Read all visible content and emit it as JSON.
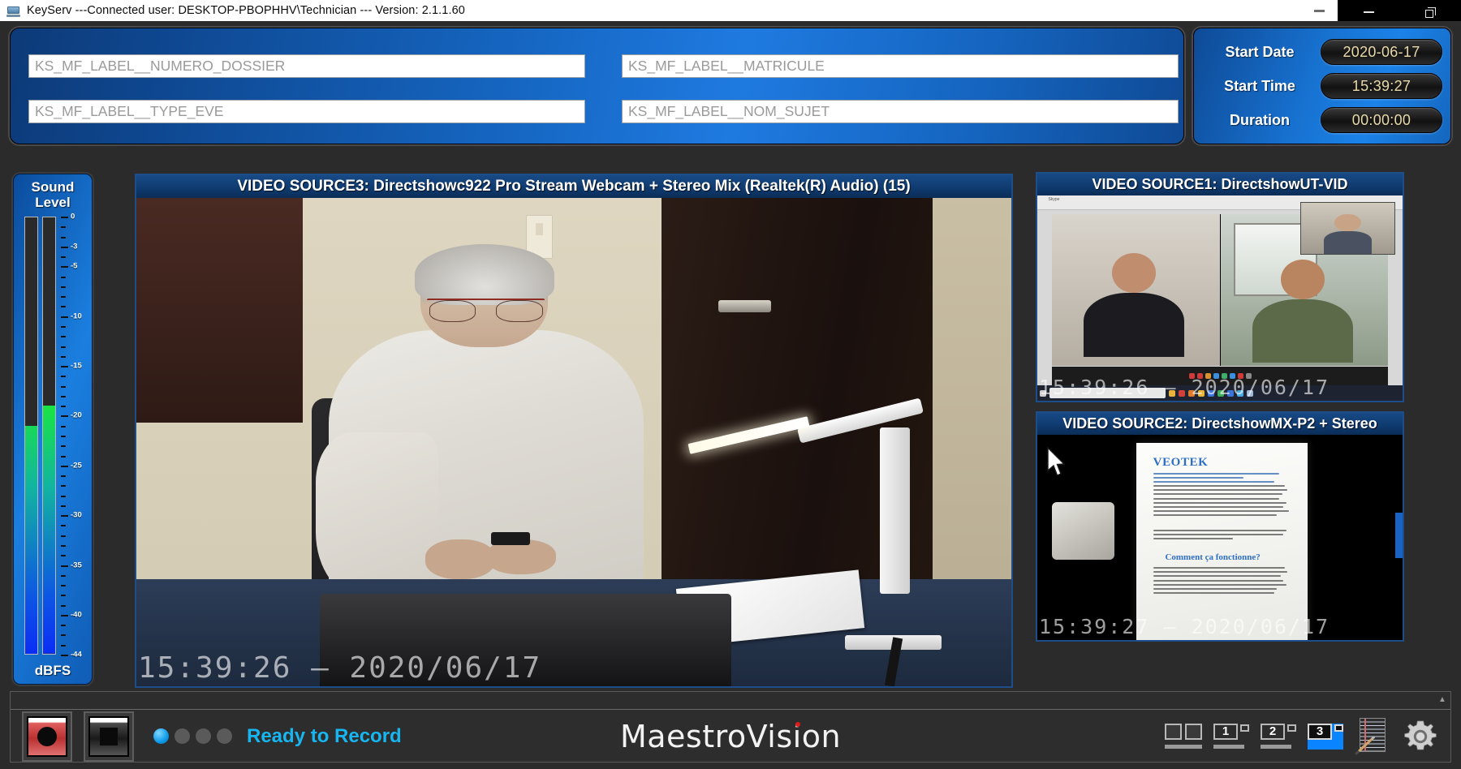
{
  "titlebar": {
    "app_icon": "keyserv-icon",
    "title": "KeyServ ---Connected user:  DESKTOP-PBOPHHV\\Technician --- Version:  2.1.1.60",
    "minimize_label": "–",
    "restore_label": "❐"
  },
  "header_form": {
    "fields": [
      {
        "name": "numero-dossier",
        "placeholder": "KS_MF_LABEL__NUMERO_DOSSIER",
        "value": ""
      },
      {
        "name": "type-eve",
        "placeholder": "KS_MF_LABEL__TYPE_EVE",
        "value": ""
      },
      {
        "name": "matricule",
        "placeholder": "KS_MF_LABEL__MATRICULE",
        "value": ""
      },
      {
        "name": "nom-sujet",
        "placeholder": "KS_MF_LABEL__NOM_SUJET",
        "value": ""
      }
    ]
  },
  "time_panel": {
    "rows": [
      {
        "label": "Start Date",
        "value": "2020-06-17"
      },
      {
        "label": "Start Time",
        "value": "15:39:27"
      },
      {
        "label": "Duration",
        "value": "00:00:00"
      }
    ],
    "value_color": "#e8d9a8"
  },
  "sound_meter": {
    "title_line1": "Sound",
    "title_line2": "Level",
    "unit": "dBFS",
    "scale_labels": [
      "0",
      "-3",
      "-5",
      "-10",
      "-15",
      "-20",
      "-25",
      "-30",
      "-35",
      "-40",
      "-44"
    ],
    "left_channel_dbfs": -21,
    "right_channel_dbfs": -19,
    "range_min_dbfs": -44,
    "range_max_dbfs": 0,
    "fill_color_top": "#1dfb1d",
    "fill_color_bottom": "#0b2df5"
  },
  "videos": {
    "main": {
      "header": "VIDEO SOURCE3: Directshowc922 Pro Stream Webcam + Stereo Mix (Realtek(R) Audio) (15)",
      "timestamp": "15:39:26  —  2020/06/17"
    },
    "source1": {
      "header": "VIDEO SOURCE1: DirectshowUT-VID",
      "timestamp": "15:39:26  —  2020/06/17"
    },
    "source2": {
      "header": "VIDEO SOURCE2: DirectshowMX-P2 + Stereo",
      "timestamp": "15:39:27  —  2020/06/17",
      "document": {
        "heading": "VEOTEK",
        "subheading": "Comment ça fonctionne?"
      }
    }
  },
  "bottom_bar": {
    "record_button_label": "record-button",
    "stop_button_label": "stop-button",
    "status_text": "Ready to Record",
    "status_color": "#18b6f0",
    "status_dots_total": 4,
    "status_dots_active": 1,
    "brand": "MaestroVision",
    "brand_accent_color": "#e01b1b",
    "layout_buttons": [
      {
        "name": "layout-dual",
        "label": "",
        "active": false
      },
      {
        "name": "layout-preset-1",
        "label": "1",
        "active": false
      },
      {
        "name": "layout-preset-2",
        "label": "2",
        "active": false
      },
      {
        "name": "layout-preset-3",
        "label": "3",
        "active": true
      }
    ],
    "notes_button": "notepad-icon",
    "settings_button": "gear-icon",
    "scroll_up_glyph": "▲"
  }
}
